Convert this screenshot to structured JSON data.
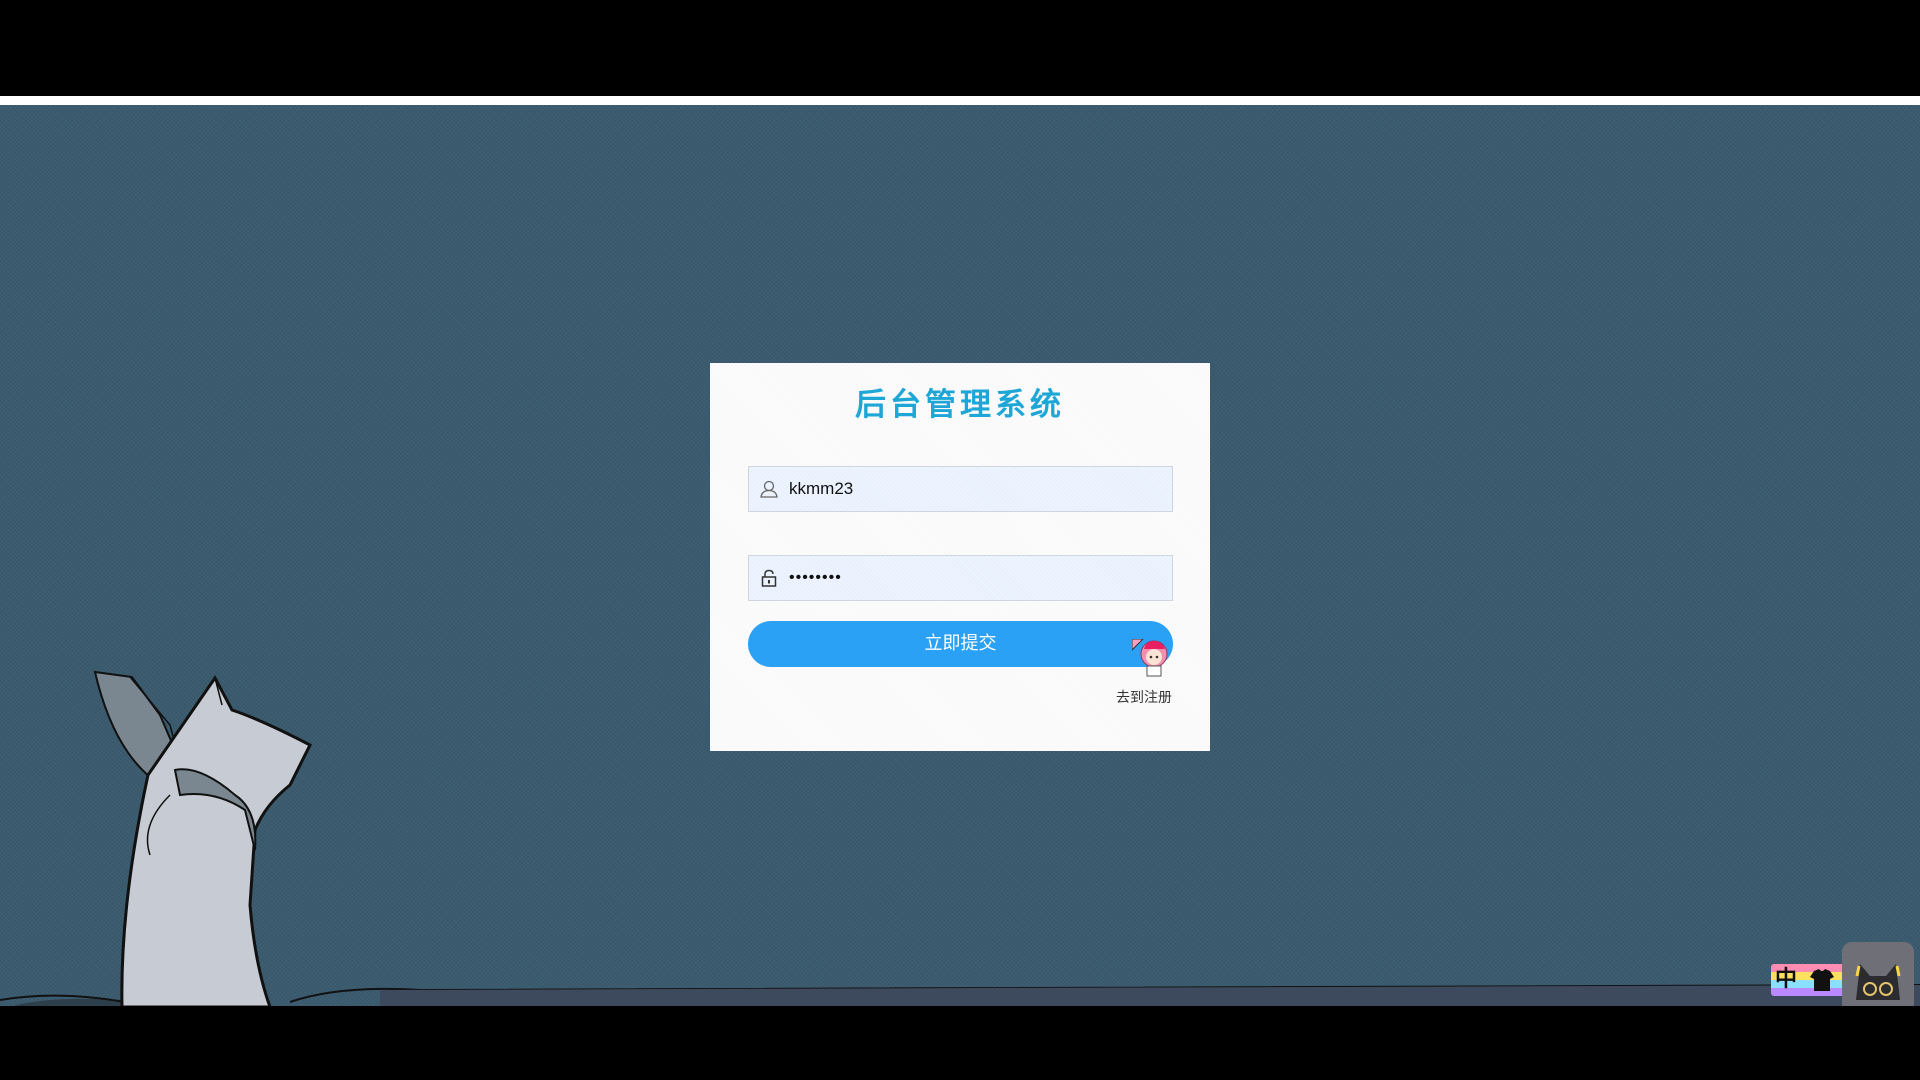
{
  "login": {
    "title": "后台管理系统",
    "username_value": "kkmm23",
    "password_value": "••••••••",
    "submit_label": "立即提交",
    "register_label": "去到注册"
  },
  "ime": {
    "language_label": "中"
  },
  "colors": {
    "background": "#3a5a6e",
    "title": "#1ea6d6",
    "button": "#2ba1f5",
    "input_fill": "#e8f0fe"
  },
  "icons": {
    "username": "user-icon",
    "password": "lock-icon",
    "ime_skin": "shirt-icon",
    "ime_assistant": "cat-avatar-icon"
  }
}
